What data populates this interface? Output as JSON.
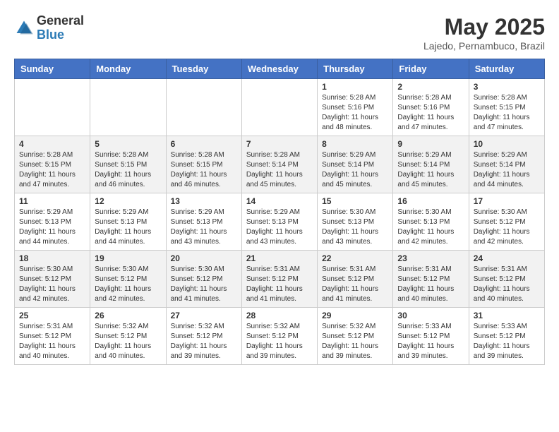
{
  "header": {
    "logo_general": "General",
    "logo_blue": "Blue",
    "month_title": "May 2025",
    "location": "Lajedo, Pernambuco, Brazil"
  },
  "weekdays": [
    "Sunday",
    "Monday",
    "Tuesday",
    "Wednesday",
    "Thursday",
    "Friday",
    "Saturday"
  ],
  "weeks": [
    [
      {
        "day": "",
        "info": ""
      },
      {
        "day": "",
        "info": ""
      },
      {
        "day": "",
        "info": ""
      },
      {
        "day": "",
        "info": ""
      },
      {
        "day": "1",
        "info": "Sunrise: 5:28 AM\nSunset: 5:16 PM\nDaylight: 11 hours\nand 48 minutes."
      },
      {
        "day": "2",
        "info": "Sunrise: 5:28 AM\nSunset: 5:16 PM\nDaylight: 11 hours\nand 47 minutes."
      },
      {
        "day": "3",
        "info": "Sunrise: 5:28 AM\nSunset: 5:15 PM\nDaylight: 11 hours\nand 47 minutes."
      }
    ],
    [
      {
        "day": "4",
        "info": "Sunrise: 5:28 AM\nSunset: 5:15 PM\nDaylight: 11 hours\nand 47 minutes."
      },
      {
        "day": "5",
        "info": "Sunrise: 5:28 AM\nSunset: 5:15 PM\nDaylight: 11 hours\nand 46 minutes."
      },
      {
        "day": "6",
        "info": "Sunrise: 5:28 AM\nSunset: 5:15 PM\nDaylight: 11 hours\nand 46 minutes."
      },
      {
        "day": "7",
        "info": "Sunrise: 5:28 AM\nSunset: 5:14 PM\nDaylight: 11 hours\nand 45 minutes."
      },
      {
        "day": "8",
        "info": "Sunrise: 5:29 AM\nSunset: 5:14 PM\nDaylight: 11 hours\nand 45 minutes."
      },
      {
        "day": "9",
        "info": "Sunrise: 5:29 AM\nSunset: 5:14 PM\nDaylight: 11 hours\nand 45 minutes."
      },
      {
        "day": "10",
        "info": "Sunrise: 5:29 AM\nSunset: 5:14 PM\nDaylight: 11 hours\nand 44 minutes."
      }
    ],
    [
      {
        "day": "11",
        "info": "Sunrise: 5:29 AM\nSunset: 5:13 PM\nDaylight: 11 hours\nand 44 minutes."
      },
      {
        "day": "12",
        "info": "Sunrise: 5:29 AM\nSunset: 5:13 PM\nDaylight: 11 hours\nand 44 minutes."
      },
      {
        "day": "13",
        "info": "Sunrise: 5:29 AM\nSunset: 5:13 PM\nDaylight: 11 hours\nand 43 minutes."
      },
      {
        "day": "14",
        "info": "Sunrise: 5:29 AM\nSunset: 5:13 PM\nDaylight: 11 hours\nand 43 minutes."
      },
      {
        "day": "15",
        "info": "Sunrise: 5:30 AM\nSunset: 5:13 PM\nDaylight: 11 hours\nand 43 minutes."
      },
      {
        "day": "16",
        "info": "Sunrise: 5:30 AM\nSunset: 5:13 PM\nDaylight: 11 hours\nand 42 minutes."
      },
      {
        "day": "17",
        "info": "Sunrise: 5:30 AM\nSunset: 5:12 PM\nDaylight: 11 hours\nand 42 minutes."
      }
    ],
    [
      {
        "day": "18",
        "info": "Sunrise: 5:30 AM\nSunset: 5:12 PM\nDaylight: 11 hours\nand 42 minutes."
      },
      {
        "day": "19",
        "info": "Sunrise: 5:30 AM\nSunset: 5:12 PM\nDaylight: 11 hours\nand 42 minutes."
      },
      {
        "day": "20",
        "info": "Sunrise: 5:30 AM\nSunset: 5:12 PM\nDaylight: 11 hours\nand 41 minutes."
      },
      {
        "day": "21",
        "info": "Sunrise: 5:31 AM\nSunset: 5:12 PM\nDaylight: 11 hours\nand 41 minutes."
      },
      {
        "day": "22",
        "info": "Sunrise: 5:31 AM\nSunset: 5:12 PM\nDaylight: 11 hours\nand 41 minutes."
      },
      {
        "day": "23",
        "info": "Sunrise: 5:31 AM\nSunset: 5:12 PM\nDaylight: 11 hours\nand 40 minutes."
      },
      {
        "day": "24",
        "info": "Sunrise: 5:31 AM\nSunset: 5:12 PM\nDaylight: 11 hours\nand 40 minutes."
      }
    ],
    [
      {
        "day": "25",
        "info": "Sunrise: 5:31 AM\nSunset: 5:12 PM\nDaylight: 11 hours\nand 40 minutes."
      },
      {
        "day": "26",
        "info": "Sunrise: 5:32 AM\nSunset: 5:12 PM\nDaylight: 11 hours\nand 40 minutes."
      },
      {
        "day": "27",
        "info": "Sunrise: 5:32 AM\nSunset: 5:12 PM\nDaylight: 11 hours\nand 39 minutes."
      },
      {
        "day": "28",
        "info": "Sunrise: 5:32 AM\nSunset: 5:12 PM\nDaylight: 11 hours\nand 39 minutes."
      },
      {
        "day": "29",
        "info": "Sunrise: 5:32 AM\nSunset: 5:12 PM\nDaylight: 11 hours\nand 39 minutes."
      },
      {
        "day": "30",
        "info": "Sunrise: 5:33 AM\nSunset: 5:12 PM\nDaylight: 11 hours\nand 39 minutes."
      },
      {
        "day": "31",
        "info": "Sunrise: 5:33 AM\nSunset: 5:12 PM\nDaylight: 11 hours\nand 39 minutes."
      }
    ]
  ]
}
